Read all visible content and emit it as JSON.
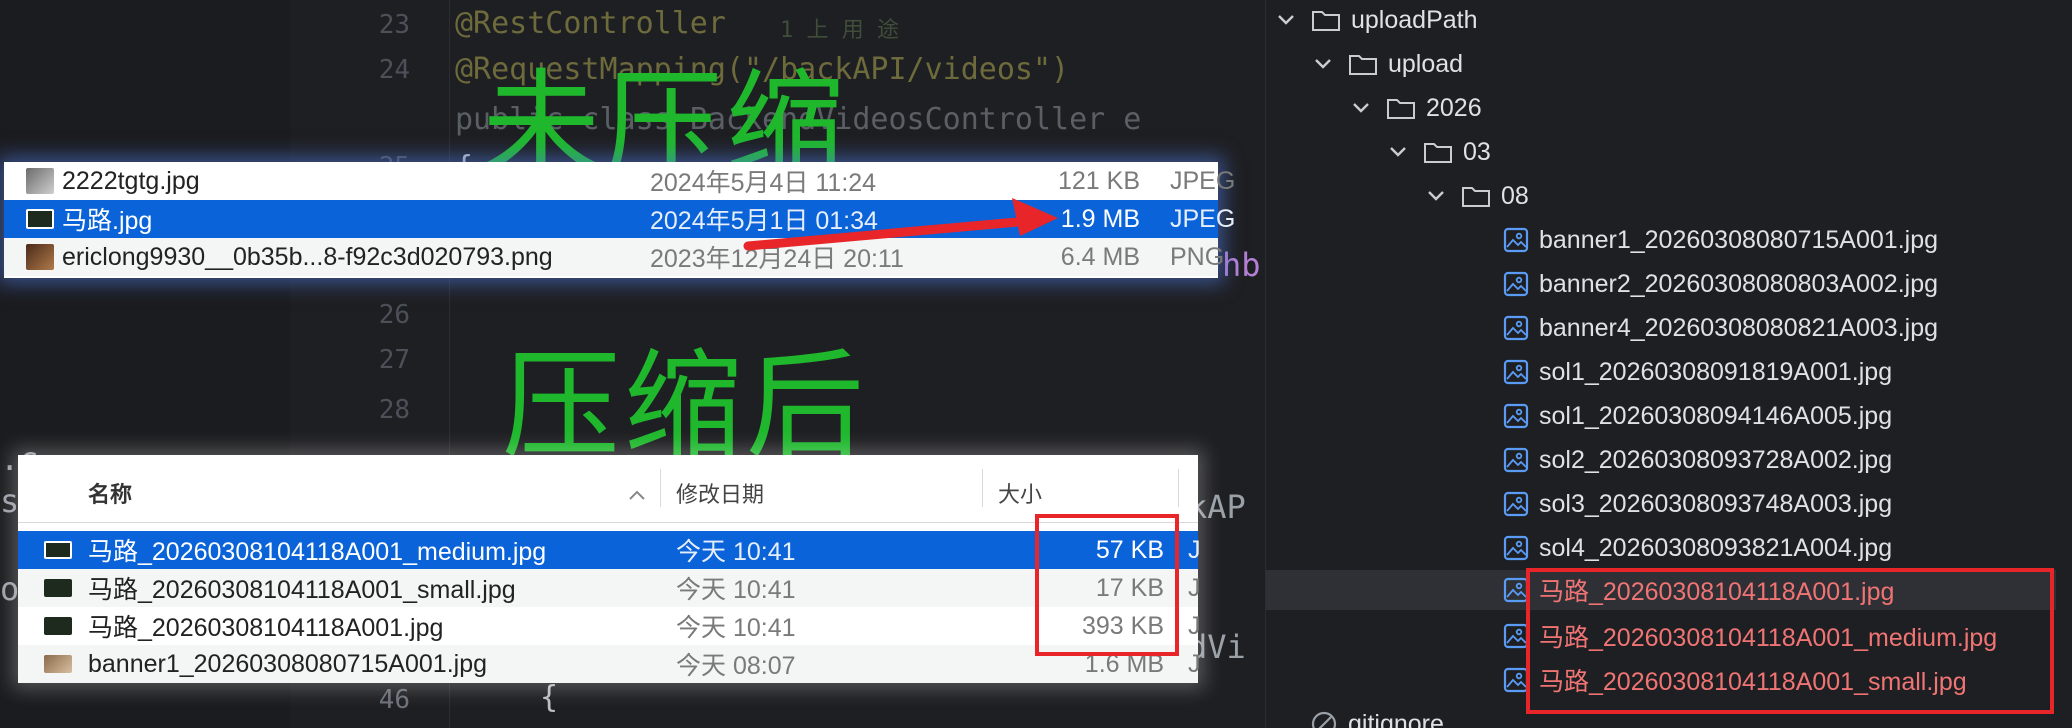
{
  "editor": {
    "line_numbers": [
      "23",
      "24",
      "25",
      "26",
      "27",
      "28",
      "46"
    ],
    "code_lines": [
      "@RestController",
      "@RequestMapping(\"/backAPI/videos\")",
      "public class BackendVideosController e",
      "{",
      "{"
    ],
    "annotation_comment": "1 上 用 途",
    "side_fragments": [
      "hb",
      "kAP",
      "dVi",
      ".c",
      "sh",
      "oa"
    ]
  },
  "headings": {
    "before": "未压缩",
    "after": "压缩后"
  },
  "finder_top": {
    "rows": [
      {
        "name": "2222tgtg.jpg",
        "date": "2024年5月4日 11:24",
        "size": "121 KB",
        "kind": "JPEG"
      },
      {
        "name": "马路.jpg",
        "date": "2024年5月1日 01:34",
        "size": "1.9 MB",
        "kind": "JPEG"
      },
      {
        "name": "ericlong9930__0b35b...8-f92c3d020793.png",
        "date": "2023年12月24日 20:11",
        "size": "6.4 MB",
        "kind": "PNG"
      }
    ]
  },
  "finder_bottom": {
    "columns": {
      "name": "名称",
      "date": "修改日期",
      "size": "大小"
    },
    "rows": [
      {
        "name": "马路_20260308104118A001_medium.jpg",
        "date": "今天 10:41",
        "size": "57 KB",
        "kind": "J"
      },
      {
        "name": "马路_20260308104118A001_small.jpg",
        "date": "今天 10:41",
        "size": "17 KB",
        "kind": "J"
      },
      {
        "name": "马路_20260308104118A001.jpg",
        "date": "今天 10:41",
        "size": "393 KB",
        "kind": "J"
      },
      {
        "name": "banner1_20260308080715A001.jpg",
        "date": "今天 08:07",
        "size": "1.6 MB",
        "kind": "J"
      }
    ]
  },
  "project_tree": {
    "folders": [
      {
        "label": "uploadPath"
      },
      {
        "label": "upload"
      },
      {
        "label": "2026"
      },
      {
        "label": "03"
      },
      {
        "label": "08"
      }
    ],
    "files": [
      {
        "label": "banner1_20260308080715A001.jpg"
      },
      {
        "label": "banner2_20260308080803A002.jpg"
      },
      {
        "label": "banner4_20260308080821A003.jpg"
      },
      {
        "label": "sol1_20260308091819A001.jpg"
      },
      {
        "label": "sol1_20260308094146A005.jpg"
      },
      {
        "label": "sol2_20260308093728A002.jpg"
      },
      {
        "label": "sol3_20260308093748A003.jpg"
      },
      {
        "label": "sol4_20260308093821A004.jpg"
      },
      {
        "label": "马路_20260308104118A001.jpg"
      },
      {
        "label": "马路_20260308104118A001_medium.jpg"
      },
      {
        "label": "马路_20260308104118A001_small.jpg"
      }
    ],
    "gitignore_label": "gitignore"
  },
  "colors": {
    "heading_green": "#1fb82d",
    "highlight_red": "#e8262a",
    "finder_selection": "#0a63d8",
    "tree_red_text": "#f07474"
  }
}
